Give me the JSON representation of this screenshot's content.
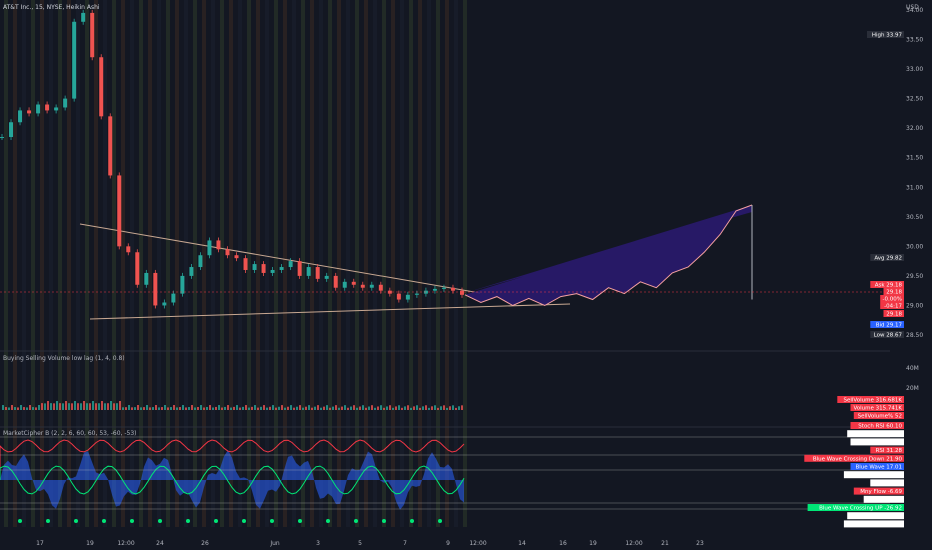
{
  "chart_data": {
    "type": "line",
    "title": "AT&T Inc., 15, NYSE, Heikin Ashi",
    "currency": "USD",
    "y_ticks": [
      "34.00",
      "33.50",
      "33.00",
      "32.50",
      "32.00",
      "31.50",
      "31.00",
      "30.50",
      "30.00",
      "29.50",
      "29.00",
      "28.50"
    ],
    "ylim": [
      28.5,
      34.05
    ],
    "x_ticks": [
      "17",
      "19",
      "12:00",
      "24",
      "26",
      "Jun",
      "3",
      "5",
      "7",
      "9",
      "12:00",
      "14",
      "16",
      "19",
      "12:00",
      "21",
      "23"
    ],
    "price_series": {
      "name": "Price",
      "y": [
        31.85,
        32.1,
        32.3,
        32.25,
        32.4,
        32.3,
        32.35,
        32.5,
        33.8,
        33.95,
        33.2,
        32.2,
        31.2,
        30.0,
        29.9,
        29.35,
        29.55,
        29.0,
        29.05,
        29.2,
        29.5,
        29.65,
        29.85,
        30.1,
        29.95,
        29.85,
        29.8,
        29.6,
        29.7,
        29.55,
        29.6,
        29.65,
        29.75,
        29.5,
        29.65,
        29.45,
        29.5,
        29.3,
        29.4,
        29.35,
        29.3,
        29.35,
        29.25,
        29.2,
        29.1,
        29.18,
        29.2,
        29.25,
        29.28,
        29.3,
        29.25,
        29.18
      ]
    },
    "projection": {
      "name": "Forecast",
      "y": [
        29.18,
        29.05,
        29.15,
        29.0,
        29.12,
        29.0,
        29.15,
        29.2,
        29.1,
        29.3,
        29.2,
        29.4,
        29.3,
        29.55,
        29.65,
        29.9,
        30.2,
        30.6,
        30.7,
        29.1
      ]
    },
    "price_labels": [
      {
        "name": "High",
        "value": "33.97",
        "color": "#2a2e39"
      },
      {
        "name": "Avg",
        "value": "29.82",
        "color": "#2a2e39"
      },
      {
        "name": "Ask",
        "value": "29.18",
        "color": "#f23645"
      },
      {
        "name": "",
        "value": "29.18",
        "color": "#f23645"
      },
      {
        "name": "",
        "value": "-0.00%",
        "color": "#f23645"
      },
      {
        "name": "",
        "value": "-04:17",
        "color": "#f23645"
      },
      {
        "name": "",
        "value": "29.18",
        "color": "#f23645"
      },
      {
        "name": "Bid",
        "value": "29.17",
        "color": "#2962ff"
      },
      {
        "name": "Low",
        "value": "28.67",
        "color": "#2a2e39"
      }
    ],
    "volume_panel": {
      "title": "Buying Selling Volume low lag (1, 4, 0.8)",
      "y_ticks": [
        "40M",
        "20M"
      ],
      "labels": [
        {
          "name": "SellVolume",
          "value": "316.681K",
          "color": "#f23645"
        },
        {
          "name": "Volume",
          "value": "315.741K",
          "color": "#f23645"
        },
        {
          "name": "SellVolume%",
          "value": "52",
          "color": "#f23645"
        }
      ]
    },
    "oscillator_panel": {
      "title": "MarketCipher B (2, 2, 6, 60, 60, 53, -60, -53)",
      "labels": [
        {
          "name": "Stoch RSI",
          "value": "60.10",
          "color": "#f23645"
        },
        {
          "name": "OS 3 Solid",
          "value": "60.00",
          "color": "#ffffff"
        },
        {
          "name": "Trigger 1",
          "value": "53.00",
          "color": "#ffffff"
        },
        {
          "name": "RSI",
          "value": "31.28",
          "color": "#f23645"
        },
        {
          "name": "Blue Wave Crossing Down",
          "value": "21.90",
          "color": "#f23645"
        },
        {
          "name": "Blue Wave",
          "value": "17.01",
          "color": "#2962ff"
        },
        {
          "name": "Lt Blue Wave",
          "value": "2.82",
          "color": "#ffffff"
        },
        {
          "name": "Zero",
          "value": "0.00",
          "color": "#ffffff"
        },
        {
          "name": "Mny Flow",
          "value": "-6.69",
          "color": "#f23645"
        },
        {
          "name": "VWAP",
          "value": "-14.99",
          "color": "#ffffff"
        },
        {
          "name": "Blue Wave Crossing UP",
          "value": "-26.92",
          "color": "#00e676"
        },
        {
          "name": "Trigger 2",
          "value": "-53.00",
          "color": "#ffffff"
        },
        {
          "name": "OS 3 Solid",
          "value": "-60.00",
          "color": "#ffffff"
        }
      ]
    }
  },
  "colors": {
    "background": "#131722",
    "up": "#26a69a",
    "down": "#ef5350",
    "trendline": "#c8a892",
    "projection_fill": "#2a1a6e",
    "projection_line": "#f7a1a1"
  }
}
